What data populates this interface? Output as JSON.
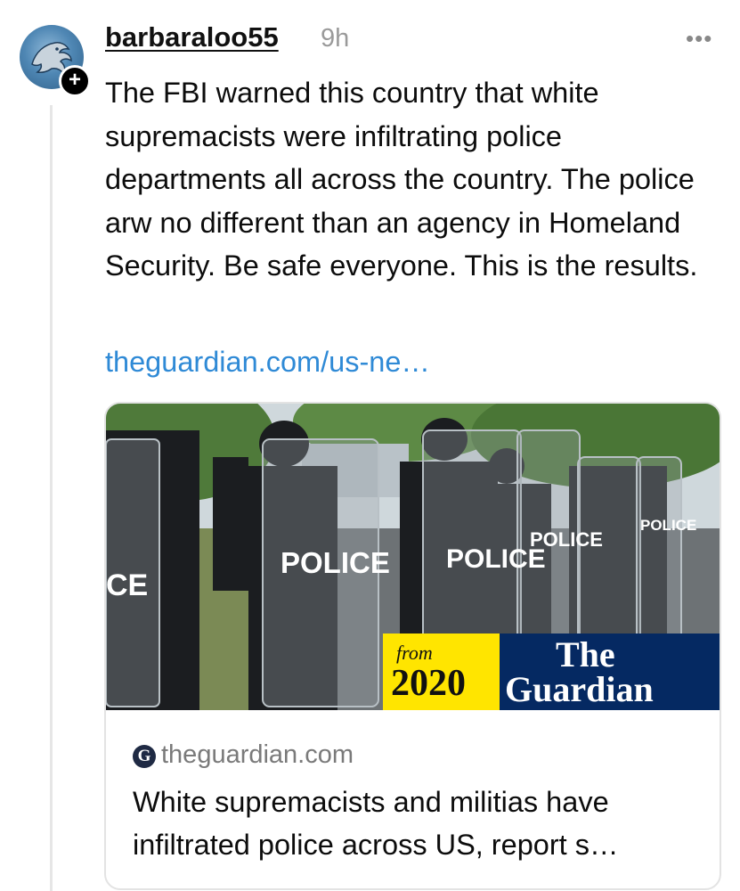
{
  "post": {
    "username": "barbaraloo55",
    "time": "9h",
    "more_label": "•••",
    "text": "The FBI warned this country that white supremacists were infiltrating police departments all across the country. The police arw no different than an agency in Homeland Security. Be safe everyone. This is the results.",
    "link": "theguardian.com/us-ne…"
  },
  "avatar": {
    "icon": "lion-logo-icon",
    "badge": "+"
  },
  "card": {
    "image_alt_text": {
      "from": "from",
      "year": "2020",
      "brand_line1": "The",
      "brand_line2": "Guardian",
      "shield_main": "POLICE",
      "shield_left": "CE",
      "shield_small": "POLICE"
    },
    "source_icon": "G",
    "source": "theguardian.com",
    "headline": "White supremacists and militias have infiltrated police across US, report s…"
  },
  "colors": {
    "link": "#2f8ad6",
    "guardian_blue": "#052962",
    "year_yellow": "#ffe500",
    "muted": "#9a9a9a"
  }
}
